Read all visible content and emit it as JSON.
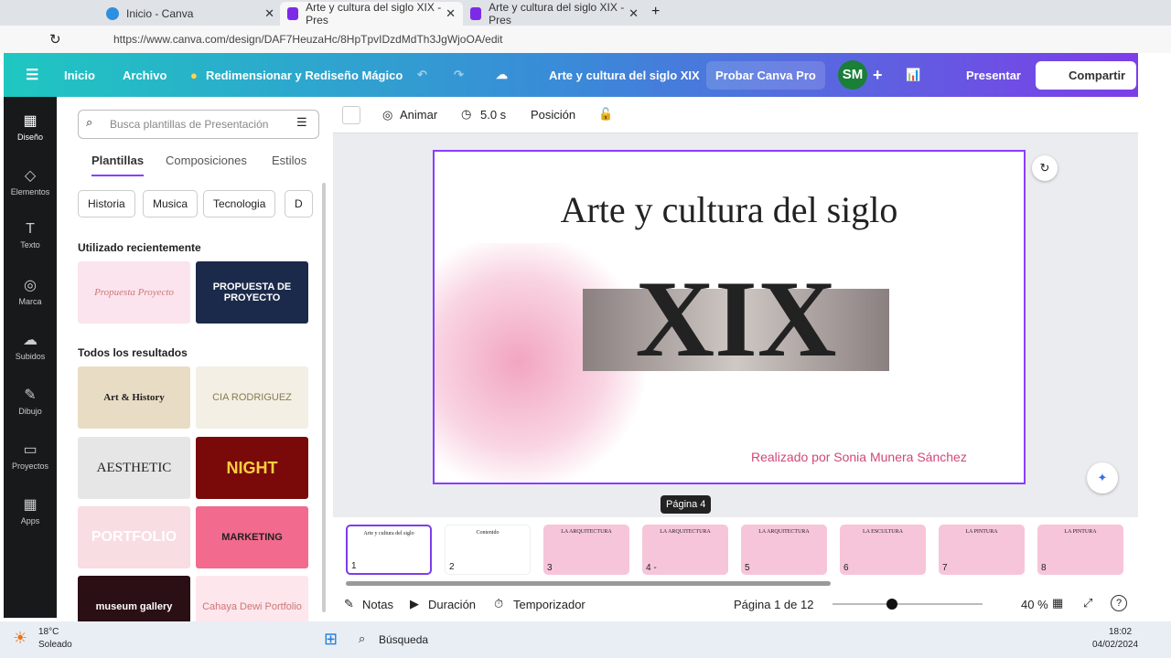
{
  "browser": {
    "tabs": [
      {
        "title": "Inicio - Canva"
      },
      {
        "title": "Arte y cultura del siglo XIX - Pres"
      },
      {
        "title": "Arte y cultura del siglo XIX - Pres"
      }
    ],
    "url": "https://www.canva.com/design/DAF7HeuzaHc/8HpTpvIDzdMdTh3JgWjoOA/edit"
  },
  "topbar": {
    "home": "Inicio",
    "file": "Archivo",
    "magic": "Redimensionar y Rediseño Mágico",
    "title": "Arte y cultura del siglo XIX",
    "pro": "Probar Canva Pro",
    "avatar": "SM",
    "present": "Presentar",
    "share": "Compartir"
  },
  "rail": [
    {
      "label": "Diseño",
      "icon": "▦"
    },
    {
      "label": "Elementos",
      "icon": "◇"
    },
    {
      "label": "Texto",
      "icon": "T"
    },
    {
      "label": "Marca",
      "icon": "◎"
    },
    {
      "label": "Subidos",
      "icon": "☁"
    },
    {
      "label": "Dibujo",
      "icon": "✎"
    },
    {
      "label": "Proyectos",
      "icon": "▭"
    },
    {
      "label": "Apps",
      "icon": "▦"
    }
  ],
  "panel": {
    "search_placeholder": "Busca plantillas de Presentación",
    "tabs": [
      "Plantillas",
      "Composiciones",
      "Estilos"
    ],
    "chips": [
      "Historia",
      "Musica",
      "Tecnologia",
      "D"
    ],
    "recent_heading": "Utilizado recientemente",
    "recent": [
      "Propuesta Proyecto",
      "PROPUESTA DE PROYECTO"
    ],
    "all_heading": "Todos los resultados",
    "results": [
      "Art & History",
      "CIA RODRIGUEZ",
      "AESTHETIC",
      "NIGHT",
      "PORTFOLIO",
      "MARKETING",
      "museum gallery",
      "Cahaya Dewi Portfolio"
    ]
  },
  "toolbar": {
    "animate": "Animar",
    "duration": "5.0 s",
    "position": "Posición"
  },
  "slide": {
    "title": "Arte y cultura del siglo",
    "big": "XIX",
    "author": "Realizado por Sonia Munera Sánchez"
  },
  "tooltip": "Página 4",
  "pages": [
    {
      "n": "1",
      "t": "Arte y cultura del siglo"
    },
    {
      "n": "2",
      "t": "Contenido"
    },
    {
      "n": "3",
      "t": "LA ARQUITECTURA"
    },
    {
      "n": "4 -",
      "t": "LA ARQUITECTURA"
    },
    {
      "n": "5",
      "t": "LA ARQUITECTURA"
    },
    {
      "n": "6",
      "t": "LA ESCULTURA"
    },
    {
      "n": "7",
      "t": "LA PINTURA"
    },
    {
      "n": "8",
      "t": "LA PINTURA"
    }
  ],
  "footer": {
    "notes": "Notas",
    "duration": "Duración",
    "timer": "Temporizador",
    "page": "Página 1 de 12",
    "zoom": "40 %",
    "zoom_value": 40
  },
  "taskbar": {
    "temp": "18°C",
    "weather": "Soleado",
    "search": "Búsqueda",
    "time": "18:02",
    "date": "04/02/2024"
  }
}
